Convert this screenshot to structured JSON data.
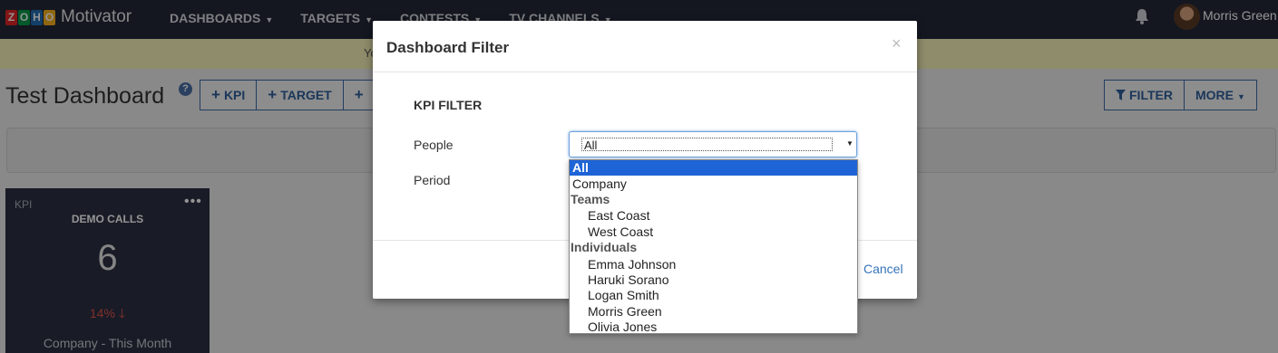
{
  "app": {
    "brand": "Motivator",
    "logo_letters": [
      "Z",
      "O",
      "H",
      "O"
    ],
    "logo_colors": [
      "#e42527",
      "#089949",
      "#226db4",
      "#f9b21d"
    ]
  },
  "nav": {
    "items": [
      "DASHBOARDS",
      "TARGETS",
      "CONTESTS",
      "TV CHANNELS"
    ],
    "user": "Morris Green"
  },
  "notice": {
    "text": "Yo"
  },
  "dashboard": {
    "title": "Test Dashboard",
    "help": "?",
    "add_kpi": "KPI",
    "add_target": "TARGET",
    "add_more": "",
    "filter": "FILTER",
    "more": "MORE"
  },
  "tile": {
    "tag": "KPI",
    "name": "DEMO CALLS",
    "value": "6",
    "change": "14%",
    "footer": "Company - This Month"
  },
  "modal": {
    "title": "Dashboard Filter",
    "close": "×",
    "section": "KPI FILTER",
    "people_label": "People",
    "period_label": "Period",
    "people_value": "All",
    "cancel": "Cancel"
  },
  "dropdown": {
    "all": "All",
    "company": "Company",
    "teams_group": "Teams",
    "teams": [
      "East Coast",
      "West Coast"
    ],
    "individuals_group": "Individuals",
    "individuals": [
      "Emma Johnson",
      "Haruki Sorano",
      "Logan Smith",
      "Morris Green",
      "Olivia Jones"
    ]
  },
  "colors": {
    "nav_bg": "#232838",
    "accent": "#2f5f9c",
    "selected_option": "#1f64d6",
    "negative": "#e0524b",
    "notice_bg": "#f4f1b7"
  }
}
